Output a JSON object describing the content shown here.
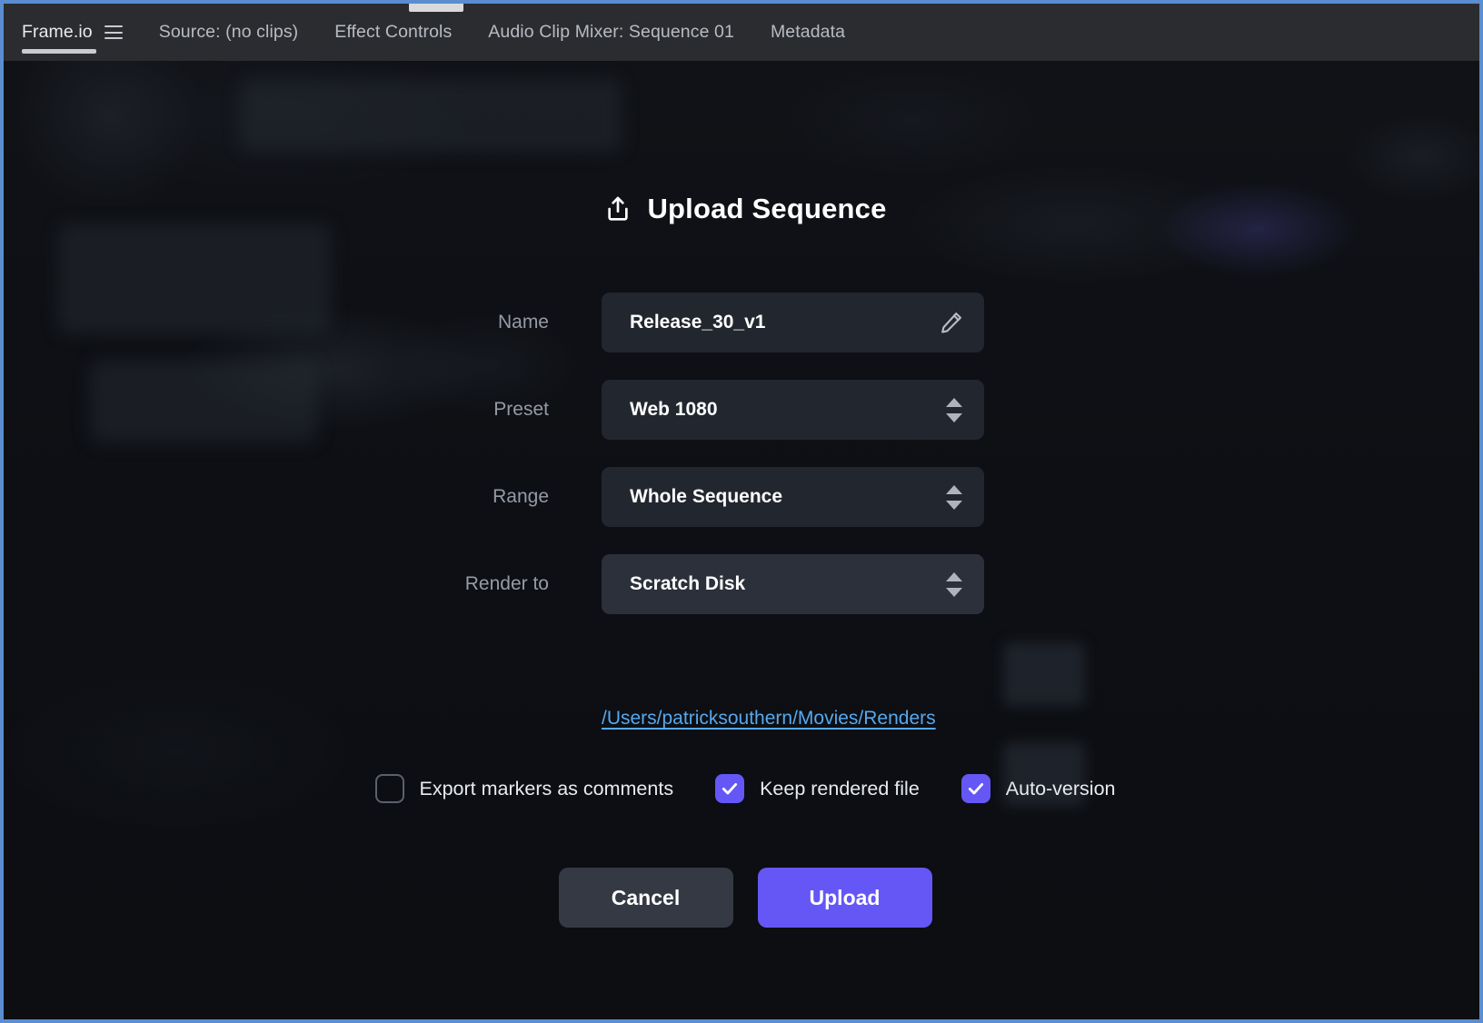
{
  "window": {
    "border_color": "#5b8dd0",
    "background_color": "#0f1116"
  },
  "tab_bar": {
    "tabs": [
      {
        "label": "Frame.io",
        "active": true,
        "has_menu_icon": true,
        "menu_icon": "hamburger-icon"
      },
      {
        "label": "Source: (no clips)",
        "active": false,
        "has_menu_icon": false
      },
      {
        "label": "Effect Controls",
        "active": false,
        "has_menu_icon": false
      },
      {
        "label": "Audio Clip Mixer: Sequence 01",
        "active": false,
        "has_menu_icon": false
      },
      {
        "label": "Metadata",
        "active": false,
        "has_menu_icon": false
      }
    ]
  },
  "dialog": {
    "title": "Upload Sequence",
    "title_icon": "upload-share-icon",
    "fields": [
      {
        "label": "Name",
        "value": "Release_30_v1",
        "control": "text-input",
        "trailing_icon": "pencil-edit-icon",
        "hovered": false
      },
      {
        "label": "Preset",
        "value": "Web 1080",
        "control": "stepper-select",
        "trailing_icon": "stepper-arrows-icon",
        "hovered": false
      },
      {
        "label": "Range",
        "value": "Whole Sequence",
        "control": "stepper-select",
        "trailing_icon": "stepper-arrows-icon",
        "hovered": false
      },
      {
        "label": "Render to",
        "value": "Scratch Disk",
        "control": "stepper-select",
        "trailing_icon": "stepper-arrows-icon",
        "hovered": true
      }
    ],
    "render_path": "/Users/patricksouthern/Movies/Renders",
    "render_path_color": "#56a8ee",
    "checkboxes": [
      {
        "label": "Export markers as comments",
        "checked": false
      },
      {
        "label": "Keep rendered file",
        "checked": true
      },
      {
        "label": "Auto-version",
        "checked": true
      }
    ],
    "buttons": {
      "cancel_label": "Cancel",
      "upload_label": "Upload"
    },
    "accent_color": "#6457f5",
    "secondary_button_color": "#343943"
  }
}
